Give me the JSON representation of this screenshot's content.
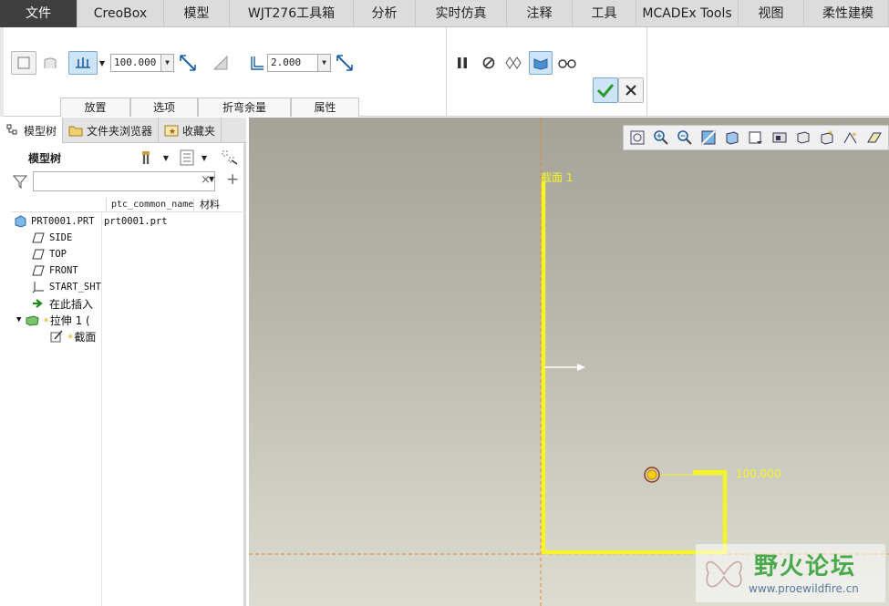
{
  "menu": {
    "items": [
      "文件",
      "CreoBox",
      "模型",
      "WJT276工具箱",
      "分析",
      "实时仿真",
      "注释",
      "工具",
      "MCADEx Tools",
      "视图",
      "柔性建模"
    ],
    "active_index": 0
  },
  "ribbon": {
    "depth_value": "100.000",
    "thickness_value": "2.000",
    "tabs": [
      "放置",
      "选项",
      "折弯余量",
      "属性"
    ]
  },
  "left_panel": {
    "tabs": [
      "模型树",
      "文件夹浏览器",
      "收藏夹"
    ],
    "title": "模型树",
    "filter_placeholder": "",
    "columns": [
      "ptc_common_name",
      "材料"
    ],
    "tree": [
      {
        "label": "PRT0001.PRT",
        "common_name": "prt0001.prt",
        "icon": "part-icon"
      },
      {
        "label": "SIDE",
        "icon": "datum-plane-icon"
      },
      {
        "label": "TOP",
        "icon": "datum-plane-icon"
      },
      {
        "label": "FRONT",
        "icon": "datum-plane-icon"
      },
      {
        "label": "START_SHT",
        "icon": "csys-icon"
      },
      {
        "label": "在此插入",
        "icon": "insert-here-icon"
      },
      {
        "label": "拉伸 1 (",
        "icon": "extrude-icon"
      },
      {
        "label": "截面",
        "icon": "sketch-icon"
      }
    ]
  },
  "viewport": {
    "section_label": "截面 1",
    "dimension_value": "100.000",
    "watermark_title": "野火论坛",
    "watermark_url": "www.proewildfire.cn"
  },
  "colors": {
    "sketch": "#f4f428",
    "menu_active_bg": "#3f3f3f",
    "accent_green": "#3aa63a"
  }
}
